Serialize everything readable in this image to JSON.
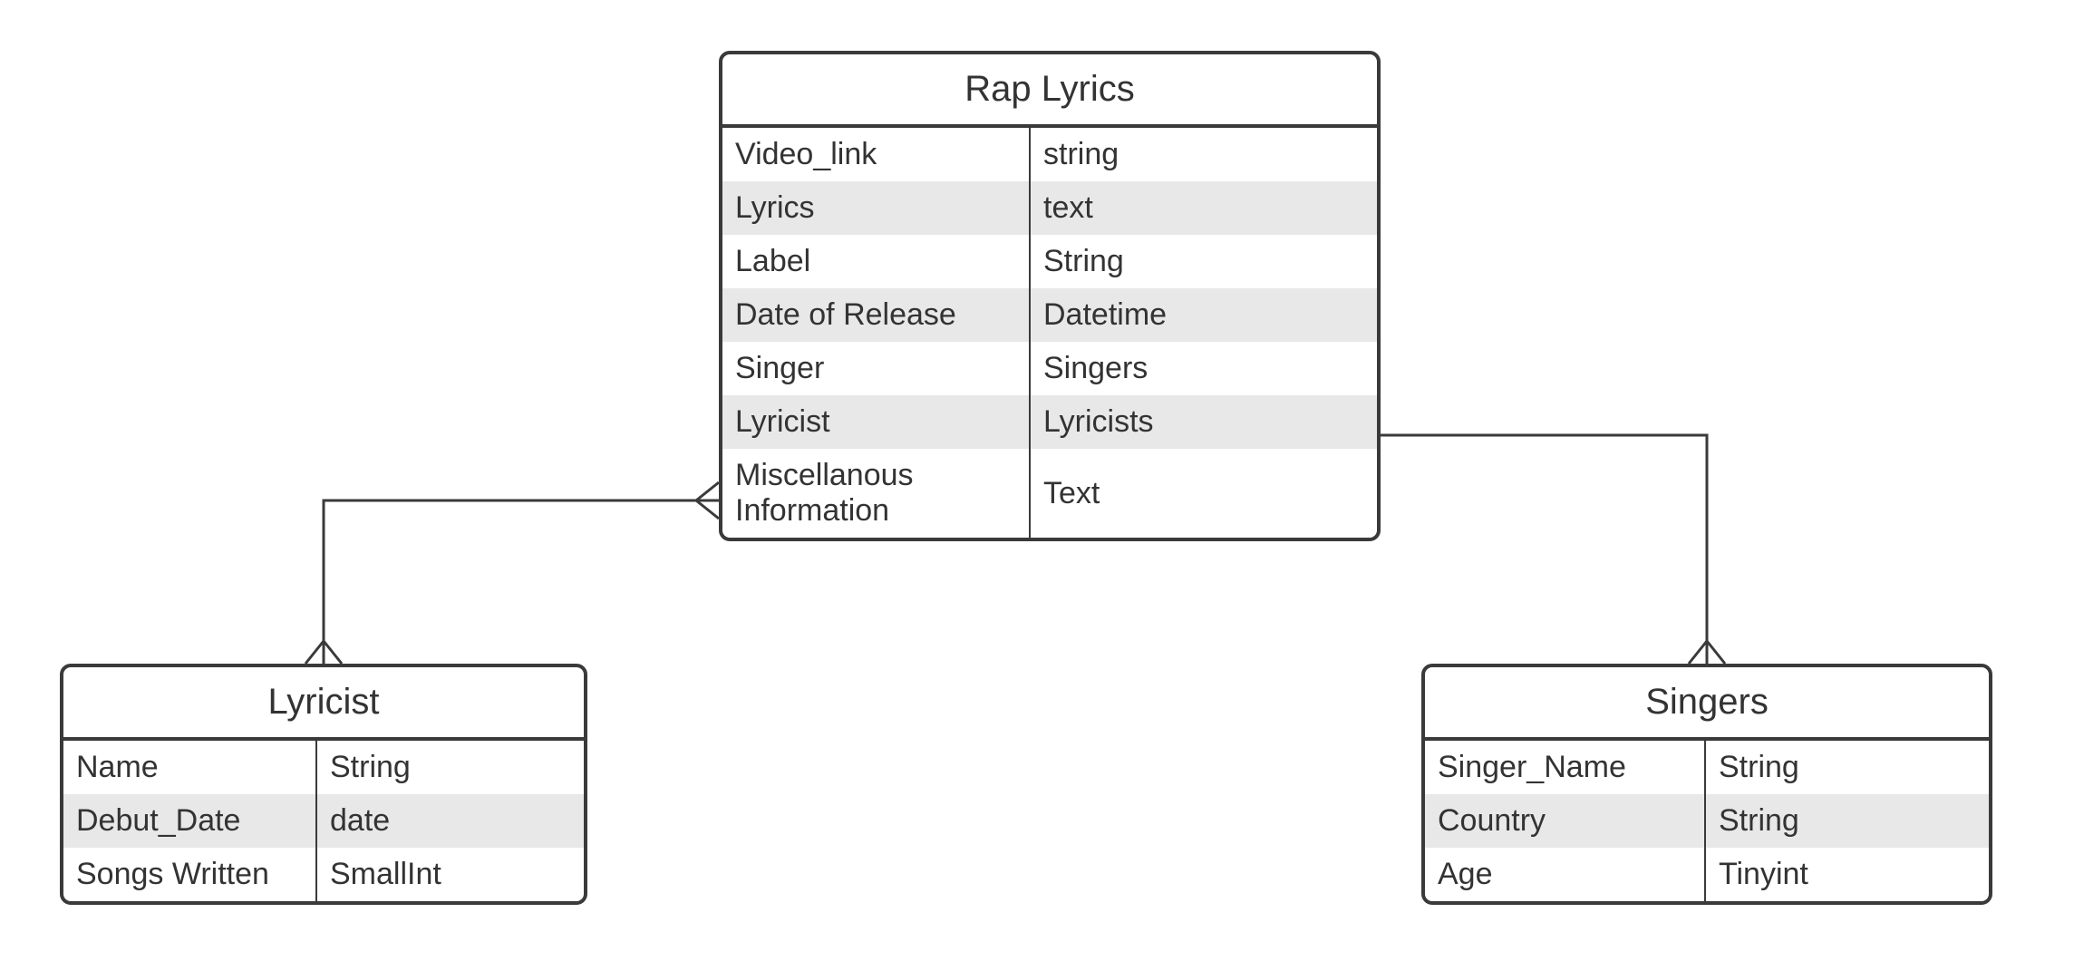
{
  "entities": {
    "rap_lyrics": {
      "title": "Rap Lyrics",
      "rows": [
        {
          "name": "Video_link",
          "type": "string"
        },
        {
          "name": "Lyrics",
          "type": "text"
        },
        {
          "name": "Label",
          "type": "String"
        },
        {
          "name": "Date of Release",
          "type": "Datetime"
        },
        {
          "name": "Singer",
          "type": "Singers"
        },
        {
          "name": "Lyricist",
          "type": "Lyricists"
        },
        {
          "name": "Miscellanous Information",
          "type": "Text"
        }
      ]
    },
    "lyricist": {
      "title": "Lyricist",
      "rows": [
        {
          "name": "Name",
          "type": "String"
        },
        {
          "name": "Debut_Date",
          "type": "date"
        },
        {
          "name": "Songs Written",
          "type": "SmallInt"
        }
      ]
    },
    "singers": {
      "title": "Singers",
      "rows": [
        {
          "name": "Singer_Name",
          "type": "String"
        },
        {
          "name": "Country",
          "type": "String"
        },
        {
          "name": "Age",
          "type": "Tinyint"
        }
      ]
    }
  },
  "relationships": [
    {
      "from": "lyricist",
      "to": "rap_lyrics",
      "type": "one-to-many"
    },
    {
      "from": "singers",
      "to": "rap_lyrics",
      "type": "one-to-many"
    }
  ]
}
